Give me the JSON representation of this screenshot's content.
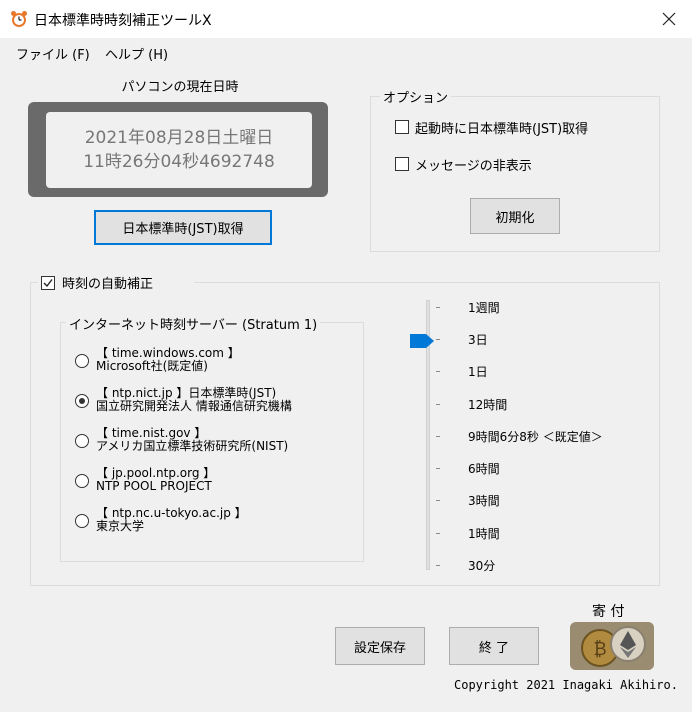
{
  "window": {
    "title": "日本標準時時刻補正ツールX"
  },
  "menu": [
    {
      "label": "ファイル (F)"
    },
    {
      "label": "ヘルプ (H)"
    }
  ],
  "clock": {
    "label": "パソコンの現在日時",
    "date": "2021年08月28日土曜日",
    "time": "11時26分04秒4692748",
    "button": "日本標準時(JST)取得"
  },
  "options": {
    "title": "オプション",
    "startup_jst": {
      "label": "起動時に日本標準時(JST)取得",
      "checked": false
    },
    "hide_message": {
      "label": "メッセージの非表示",
      "checked": false
    },
    "reset_button": "初期化"
  },
  "auto": {
    "label": "時刻の自動補正",
    "checked": true,
    "server_group_title": "インターネット時刻サーバー (Stratum 1)",
    "servers": [
      {
        "host": "【 time.windows.com 】",
        "desc": "Microsoft社(既定値)",
        "selected": false
      },
      {
        "host": "【 ntp.nict.jp 】日本標準時(JST)",
        "desc": "国立研究開発法人 情報通信研究機構",
        "selected": true
      },
      {
        "host": "【 time.nist.gov 】",
        "desc": "アメリカ国立標準技術研究所(NIST)",
        "selected": false
      },
      {
        "host": "【 jp.pool.ntp.org 】",
        "desc": "NTP POOL PROJECT",
        "selected": false
      },
      {
        "host": "【 ntp.nc.u-tokyo.ac.jp 】",
        "desc": "東京大学",
        "selected": false
      }
    ],
    "intervals": [
      "1週間",
      "3日",
      "1日",
      "12時間",
      "9時間6分8秒 ＜既定値＞",
      "6時間",
      "3時間",
      "1時間",
      "30分"
    ],
    "selected_interval_index": 1
  },
  "footer": {
    "save_button": "設定保存",
    "exit_button": "終 了",
    "donate_label": "寄 付",
    "copyright": "Copyright 2021 Inagaki Akihiro."
  },
  "colors": {
    "accent": "#0078d7",
    "clock_frame": "#6a6a6a"
  }
}
